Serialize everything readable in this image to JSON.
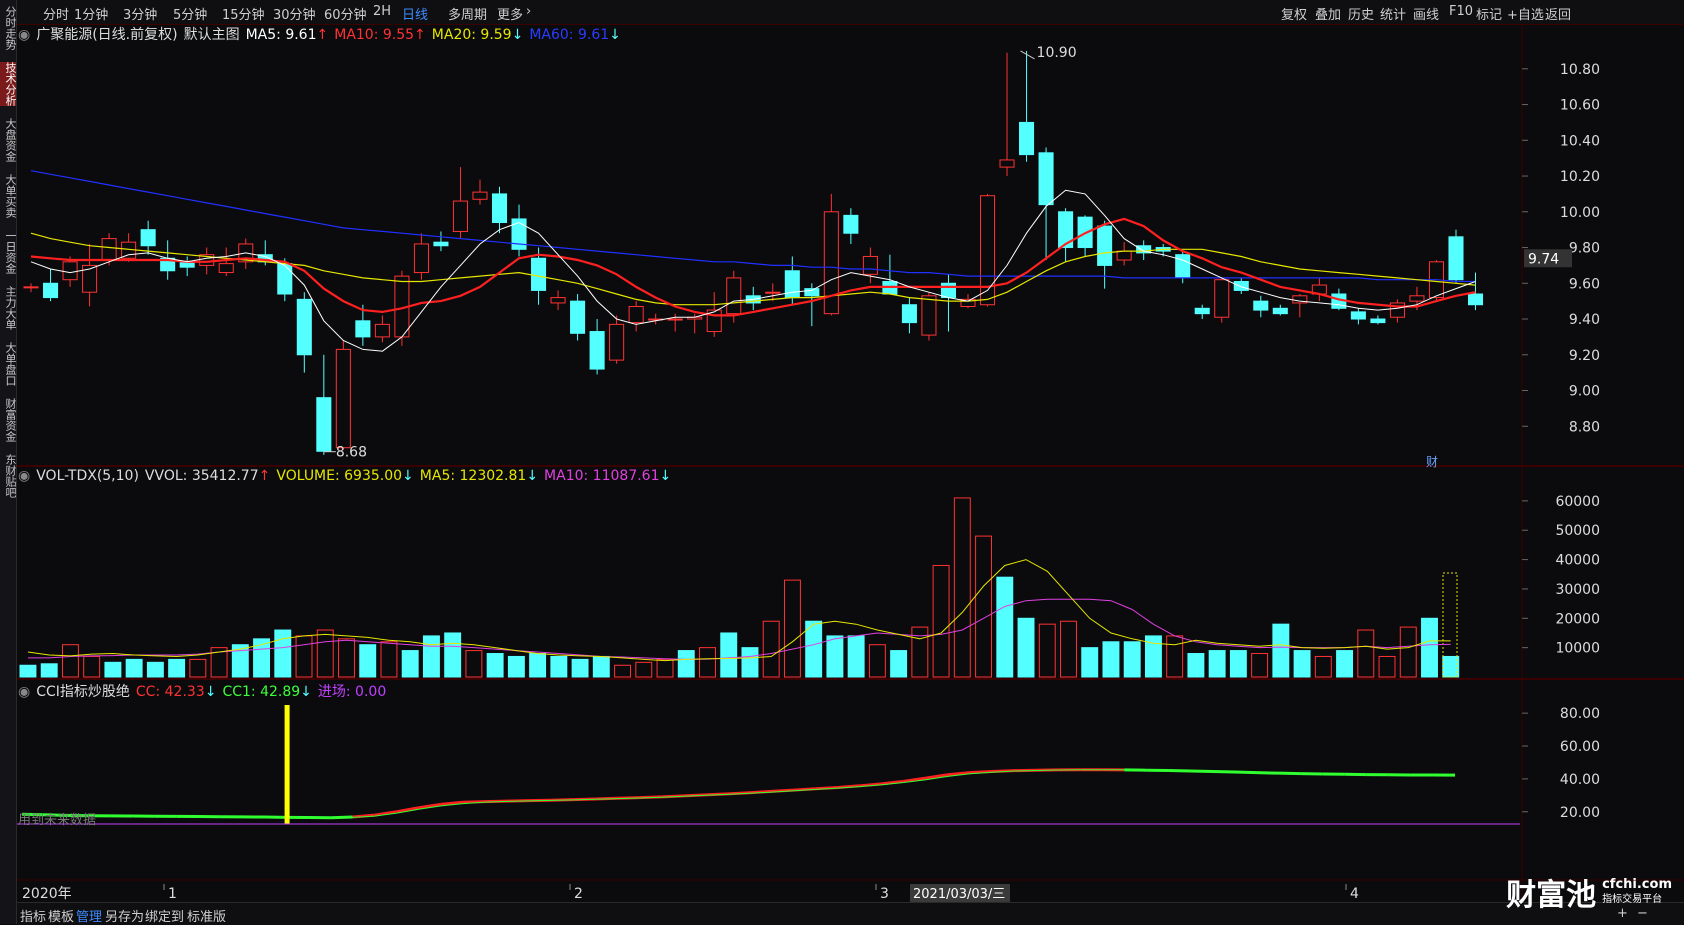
{
  "sidebar": {
    "items": [
      {
        "label": "分时走势",
        "active": false
      },
      {
        "label": "技术分析",
        "active": true
      },
      {
        "label": "大盘资金",
        "active": false
      },
      {
        "label": "大单买卖",
        "active": false
      },
      {
        "label": "一日资金",
        "active": false
      },
      {
        "label": "主力大单",
        "active": false
      },
      {
        "label": "大单盘口",
        "active": false
      },
      {
        "label": "财富资金",
        "active": false
      },
      {
        "label": "东财贴吧",
        "active": false
      }
    ]
  },
  "toolbar": {
    "periods": [
      "分时",
      "1分钟",
      "3分钟",
      "5分钟",
      "15分钟",
      "30分钟",
      "60分钟",
      "2H",
      "日线",
      "多周期",
      "更多"
    ],
    "active_period": "日线",
    "right_tools": [
      "复权",
      "叠加",
      "历史",
      "统计",
      "画线",
      "F10",
      "标记",
      "+自选",
      "返回"
    ]
  },
  "main_legend": {
    "stock": "广聚能源(日线.前复权)",
    "theme": "默认主图",
    "ma5": "MA5: 9.61",
    "ma10": "MA10: 9.55",
    "ma20": "MA20: 9.59",
    "ma60": "MA60: 9.61",
    "up": "↑",
    "down": "↓"
  },
  "vol_legend": {
    "name": "VOL-TDX(5,10)",
    "vvol": "VVOL: 35412.77",
    "volume": "VOLUME: 6935.00",
    "ma5": "MA5: 12302.81",
    "ma10": "MA10: 11087.61"
  },
  "cci_legend": {
    "name": "CCI指标炒股绝",
    "cc": "CC: 42.33",
    "cc1": "CC1: 42.89",
    "entry": "进场: 0.00",
    "note": "用到未来数据"
  },
  "price_axis": [
    "10.80",
    "10.60",
    "10.40",
    "10.20",
    "10.00",
    "9.80",
    "9.60",
    "9.40",
    "9.20",
    "9.00",
    "8.80"
  ],
  "price_current": "9.74",
  "price_high_label": "10.90",
  "price_low_label": "8.68",
  "financial_marker": "财",
  "vol_axis": [
    "60000",
    "50000",
    "40000",
    "30000",
    "20000",
    "10000"
  ],
  "cci_axis": [
    "80.00",
    "60.00",
    "40.00",
    "20.00"
  ],
  "time_axis": {
    "start": "2020年",
    "months": [
      "1",
      "2",
      "3",
      "4"
    ],
    "cursor_date": "2021/03/03/三"
  },
  "bottom_bar": {
    "items": [
      "指标",
      "模板",
      "管理",
      "另存为",
      "绑定到",
      "标准版"
    ],
    "active": "管理"
  },
  "watermark": {
    "brand": "财富池",
    "url": "cfchi.com",
    "sub": "指标交易平台"
  },
  "colors": {
    "up": "#ff3232",
    "down": "#54ffff",
    "ma5": "#ffffff",
    "ma10": "#ff2020",
    "ma20": "#e6e600",
    "ma60": "#2030ff",
    "grid": "#3a0000"
  },
  "chart_data": {
    "type": "candlestick",
    "ylim": [
      8.6,
      10.95
    ],
    "candles": [
      [
        9.58,
        9.58,
        9.55,
        9.6
      ],
      [
        9.6,
        9.52,
        9.5,
        9.68
      ],
      [
        9.62,
        9.72,
        9.58,
        9.75
      ],
      [
        9.55,
        9.7,
        9.47,
        9.82
      ],
      [
        9.73,
        9.85,
        9.7,
        9.88
      ],
      [
        9.74,
        9.83,
        9.72,
        9.88
      ],
      [
        9.9,
        9.81,
        9.76,
        9.95
      ],
      [
        9.74,
        9.67,
        9.62,
        9.84
      ],
      [
        9.72,
        9.69,
        9.64,
        9.75
      ],
      [
        9.7,
        9.76,
        9.65,
        9.8
      ],
      [
        9.66,
        9.71,
        9.64,
        9.8
      ],
      [
        9.72,
        9.82,
        9.68,
        9.85
      ],
      [
        9.76,
        9.72,
        9.7,
        9.84
      ],
      [
        9.71,
        9.54,
        9.5,
        9.74
      ],
      [
        9.51,
        9.2,
        9.1,
        9.55
      ],
      [
        8.96,
        8.66,
        8.64,
        9.2
      ],
      [
        8.68,
        9.23,
        8.67,
        9.28
      ],
      [
        9.39,
        9.3,
        9.25,
        9.48
      ],
      [
        9.3,
        9.37,
        9.27,
        9.42
      ],
      [
        9.3,
        9.64,
        9.25,
        9.67
      ],
      [
        9.66,
        9.82,
        9.62,
        9.88
      ],
      [
        9.83,
        9.81,
        9.78,
        9.89
      ],
      [
        9.89,
        10.06,
        9.85,
        10.25
      ],
      [
        10.07,
        10.11,
        10.04,
        10.18
      ],
      [
        10.1,
        9.94,
        9.88,
        10.14
      ],
      [
        9.96,
        9.79,
        9.75,
        10.04
      ],
      [
        9.74,
        9.56,
        9.48,
        9.8
      ],
      [
        9.49,
        9.52,
        9.45,
        9.56
      ],
      [
        9.5,
        9.32,
        9.28,
        9.54
      ],
      [
        9.33,
        9.12,
        9.09,
        9.4
      ],
      [
        9.17,
        9.37,
        9.15,
        9.42
      ],
      [
        9.38,
        9.47,
        9.33,
        9.5
      ],
      [
        9.4,
        9.4,
        9.37,
        9.43
      ],
      [
        9.4,
        9.4,
        9.33,
        9.43
      ],
      [
        9.4,
        9.41,
        9.32,
        9.43
      ],
      [
        9.33,
        9.45,
        9.3,
        9.55
      ],
      [
        9.43,
        9.63,
        9.38,
        9.67
      ],
      [
        9.53,
        9.49,
        9.45,
        9.58
      ],
      [
        9.55,
        9.55,
        9.5,
        9.6
      ],
      [
        9.67,
        9.52,
        9.48,
        9.75
      ],
      [
        9.57,
        9.53,
        9.36,
        9.6
      ],
      [
        9.43,
        10.0,
        9.42,
        10.1
      ],
      [
        9.98,
        9.88,
        9.82,
        10.02
      ],
      [
        9.65,
        9.75,
        9.6,
        9.8
      ],
      [
        9.61,
        9.54,
        9.55,
        9.76
      ],
      [
        9.48,
        9.38,
        9.32,
        9.52
      ],
      [
        9.31,
        9.53,
        9.28,
        9.55
      ],
      [
        9.6,
        9.52,
        9.33,
        9.65
      ],
      [
        9.47,
        9.51,
        9.46,
        9.54
      ],
      [
        9.48,
        10.09,
        9.47,
        10.1
      ],
      [
        10.25,
        10.29,
        10.2,
        10.89
      ],
      [
        10.5,
        10.32,
        10.28,
        10.9
      ],
      [
        10.33,
        10.04,
        9.73,
        10.36
      ],
      [
        10.0,
        9.8,
        9.72,
        10.02
      ],
      [
        9.97,
        9.8,
        9.75,
        9.98
      ],
      [
        9.92,
        9.7,
        9.57,
        9.95
      ],
      [
        9.73,
        9.78,
        9.7,
        9.83
      ],
      [
        9.81,
        9.77,
        9.73,
        9.84
      ],
      [
        9.8,
        9.78,
        9.75,
        9.82
      ],
      [
        9.76,
        9.63,
        9.6,
        9.78
      ],
      [
        9.46,
        9.43,
        9.4,
        9.48
      ],
      [
        9.41,
        9.62,
        9.38,
        9.63
      ],
      [
        9.61,
        9.56,
        9.54,
        9.63
      ],
      [
        9.5,
        9.45,
        9.41,
        9.53
      ],
      [
        9.46,
        9.43,
        9.42,
        9.48
      ],
      [
        9.49,
        9.53,
        9.41,
        9.54
      ],
      [
        9.54,
        9.59,
        9.5,
        9.63
      ],
      [
        9.54,
        9.46,
        9.45,
        9.57
      ],
      [
        9.44,
        9.4,
        9.37,
        9.46
      ],
      [
        9.4,
        9.38,
        9.37,
        9.42
      ],
      [
        9.41,
        9.49,
        9.38,
        9.51
      ],
      [
        9.5,
        9.53,
        9.45,
        9.58
      ],
      [
        9.52,
        9.72,
        9.5,
        9.73
      ],
      [
        9.86,
        9.62,
        9.6,
        9.9
      ],
      [
        9.54,
        9.48,
        9.45,
        9.66
      ]
    ],
    "ma5": [
      9.72,
      9.68,
      9.66,
      9.68,
      9.72,
      9.76,
      9.77,
      9.74,
      9.72,
      9.74,
      9.75,
      9.77,
      9.75,
      9.7,
      9.59,
      9.39,
      9.28,
      9.23,
      9.22,
      9.3,
      9.44,
      9.58,
      9.7,
      9.82,
      9.9,
      9.94,
      9.88,
      9.76,
      9.64,
      9.5,
      9.4,
      9.37,
      9.39,
      9.41,
      9.41,
      9.44,
      9.5,
      9.51,
      9.53,
      9.55,
      9.56,
      9.62,
      9.66,
      9.64,
      9.62,
      9.58,
      9.55,
      9.52,
      9.5,
      9.56,
      9.7,
      9.88,
      10.03,
      10.12,
      10.1,
      9.98,
      9.85,
      9.78,
      9.76,
      9.73,
      9.68,
      9.63,
      9.58,
      9.55,
      9.52,
      9.5,
      9.49,
      9.48,
      9.46,
      9.45,
      9.46,
      9.48,
      9.53,
      9.57,
      9.61
    ],
    "ma10": [
      9.75,
      9.74,
      9.73,
      9.73,
      9.73,
      9.73,
      9.73,
      9.73,
      9.72,
      9.72,
      9.73,
      9.74,
      9.73,
      9.72,
      9.67,
      9.57,
      9.5,
      9.45,
      9.44,
      9.46,
      9.49,
      9.5,
      9.53,
      9.58,
      9.66,
      9.74,
      9.76,
      9.75,
      9.73,
      9.7,
      9.65,
      9.58,
      9.52,
      9.47,
      9.44,
      9.42,
      9.42,
      9.44,
      9.46,
      9.48,
      9.5,
      9.53,
      9.56,
      9.58,
      9.58,
      9.58,
      9.58,
      9.58,
      9.58,
      9.58,
      9.6,
      9.66,
      9.74,
      9.82,
      9.88,
      9.93,
      9.96,
      9.92,
      9.84,
      9.78,
      9.74,
      9.69,
      9.66,
      9.62,
      9.58,
      9.56,
      9.54,
      9.51,
      9.49,
      9.48,
      9.47,
      9.47,
      9.5,
      9.53,
      9.55
    ],
    "ma20": [
      9.88,
      9.85,
      9.83,
      9.81,
      9.8,
      9.79,
      9.78,
      9.77,
      9.76,
      9.75,
      9.74,
      9.73,
      9.72,
      9.71,
      9.7,
      9.67,
      9.65,
      9.63,
      9.62,
      9.61,
      9.61,
      9.62,
      9.63,
      9.64,
      9.65,
      9.66,
      9.64,
      9.62,
      9.6,
      9.57,
      9.54,
      9.51,
      9.49,
      9.48,
      9.48,
      9.48,
      9.49,
      9.5,
      9.51,
      9.52,
      9.52,
      9.53,
      9.54,
      9.55,
      9.54,
      9.52,
      9.51,
      9.5,
      9.5,
      9.51,
      9.55,
      9.61,
      9.67,
      9.72,
      9.75,
      9.77,
      9.78,
      9.78,
      9.79,
      9.79,
      9.79,
      9.77,
      9.75,
      9.72,
      9.7,
      9.68,
      9.67,
      9.66,
      9.65,
      9.64,
      9.63,
      9.62,
      9.61,
      9.6,
      9.59
    ],
    "ma60": [
      10.23,
      10.21,
      10.19,
      10.17,
      10.15,
      10.13,
      10.11,
      10.09,
      10.07,
      10.05,
      10.03,
      10.01,
      9.99,
      9.97,
      9.95,
      9.93,
      9.91,
      9.9,
      9.89,
      9.88,
      9.87,
      9.86,
      9.85,
      9.84,
      9.83,
      9.82,
      9.81,
      9.8,
      9.79,
      9.78,
      9.77,
      9.76,
      9.75,
      9.74,
      9.73,
      9.72,
      9.72,
      9.71,
      9.7,
      9.7,
      9.69,
      9.69,
      9.68,
      9.68,
      9.67,
      9.66,
      9.66,
      9.65,
      9.64,
      9.64,
      9.64,
      9.64,
      9.64,
      9.64,
      9.64,
      9.64,
      9.63,
      9.63,
      9.63,
      9.63,
      9.63,
      9.63,
      9.63,
      9.63,
      9.63,
      9.63,
      9.63,
      9.63,
      9.63,
      9.62,
      9.62,
      9.62,
      9.62,
      9.61,
      9.61
    ],
    "volume": {
      "ylim": [
        0,
        62000
      ],
      "values": [
        4000,
        4500,
        11000,
        7000,
        5000,
        6000,
        5000,
        6000,
        6000,
        10000,
        11000,
        13000,
        16000,
        14000,
        16000,
        13000,
        11000,
        12000,
        9000,
        14000,
        15000,
        9000,
        8000,
        7000,
        8000,
        7000,
        6000,
        7000,
        4000,
        5000,
        6000,
        9000,
        10000,
        15000,
        10000,
        19000,
        33000,
        19000,
        14000,
        14000,
        11000,
        9000,
        17000,
        38000,
        61000,
        48000,
        34000,
        20000,
        18000,
        19000,
        10000,
        12000,
        12000,
        14000,
        14000,
        8000,
        9000,
        9000,
        8000,
        18000,
        9000,
        7000,
        9000,
        16000,
        7000,
        17000,
        20000,
        7000
      ],
      "up": [
        false,
        false,
        true,
        true,
        false,
        false,
        false,
        false,
        true,
        true,
        false,
        false,
        false,
        true,
        true,
        true,
        false,
        true,
        false,
        false,
        false,
        true,
        false,
        false,
        false,
        false,
        false,
        false,
        true,
        true,
        true,
        false,
        true,
        false,
        false,
        true,
        true,
        false,
        false,
        false,
        true,
        false,
        true,
        true,
        true,
        true,
        false,
        false,
        true,
        true,
        false,
        false,
        false,
        false,
        true,
        false,
        false,
        false,
        true,
        false,
        false,
        true,
        false,
        true,
        true,
        true,
        false,
        false
      ],
      "vol_ma5": [
        8500,
        7500,
        7200,
        7800,
        8000,
        7500,
        7200,
        7000,
        7500,
        8500,
        9500,
        11000,
        13000,
        14000,
        14500,
        14000,
        13500,
        12500,
        12000,
        11000,
        11500,
        11000,
        10000,
        9000,
        8000,
        7500,
        7200,
        7000,
        6500,
        6000,
        5600,
        6000,
        6200,
        6300,
        6500,
        7000,
        12000,
        18000,
        19000,
        18000,
        16000,
        14500,
        13000,
        15000,
        22000,
        31000,
        38000,
        40000,
        36000,
        28000,
        20000,
        15000,
        13000,
        11500,
        11000,
        12500,
        11500,
        11000,
        10500,
        11000,
        10000,
        9800,
        10000,
        10500,
        9500,
        10000,
        12300,
        12300
      ],
      "vol_ma10": [
        6500,
        6500,
        7000,
        7200,
        7300,
        7500,
        7500,
        7500,
        7800,
        8500,
        9000,
        9500,
        10000,
        11000,
        12000,
        12500,
        12000,
        11500,
        11000,
        10500,
        10500,
        10000,
        9500,
        9000,
        8500,
        8000,
        7500,
        7000,
        6800,
        6500,
        6200,
        6000,
        6100,
        6500,
        7000,
        8000,
        9500,
        11000,
        13000,
        14000,
        15000,
        14500,
        14000,
        14500,
        16000,
        20000,
        24000,
        26000,
        26500,
        26500,
        26500,
        26000,
        23000,
        18000,
        14000,
        12000,
        11000,
        10500,
        10000,
        10200,
        10000,
        10000,
        10000,
        10500,
        10000,
        10500,
        11000,
        11100
      ]
    },
    "cci": {
      "ylim": [
        15,
        88
      ],
      "cc": [
        18.5,
        18.2,
        17.8,
        17.6,
        17.5,
        17.4,
        17.3,
        17.2,
        17.1,
        17.0,
        16.9,
        16.8,
        16.6,
        16.5,
        16.4,
        16.8,
        18.0,
        20.0,
        22.5,
        24.5,
        25.8,
        26.2,
        26.5,
        26.8,
        27.0,
        27.4,
        27.8,
        28.2,
        28.6,
        29.1,
        29.7,
        30.3,
        30.9,
        31.6,
        32.4,
        33.2,
        34.0,
        34.8,
        35.8,
        37.0,
        38.5,
        40.5,
        42.5,
        43.8,
        44.5,
        45.0,
        45.3,
        45.5,
        45.6,
        45.6,
        45.5,
        45.3,
        45.1,
        44.8,
        44.5,
        44.2,
        43.8,
        43.5,
        43.2,
        43.0,
        42.8,
        42.6,
        42.5,
        42.4,
        42.4,
        42.33
      ],
      "cc1": [
        18.8,
        18.5,
        18.1,
        17.9,
        17.7,
        17.6,
        17.5,
        17.4,
        17.3,
        17.2,
        17.1,
        17.0,
        16.9,
        16.7,
        16.6,
        16.6,
        17.4,
        19.2,
        21.5,
        23.6,
        25.0,
        25.9,
        26.3,
        26.6,
        26.9,
        27.2,
        27.6,
        28.0,
        28.4,
        28.9,
        29.4,
        30.0,
        30.6,
        31.3,
        32.0,
        32.8,
        33.6,
        34.4,
        35.3,
        36.4,
        37.8,
        39.5,
        41.5,
        43.1,
        44.1,
        44.8,
        45.1,
        45.4,
        45.6,
        45.6,
        45.6,
        45.4,
        45.2,
        45.0,
        44.7,
        44.4,
        44.0,
        43.7,
        43.4,
        43.1,
        42.9,
        42.7,
        42.6,
        42.5,
        42.45,
        42.89
      ],
      "entry_signal_index": 13
    }
  }
}
